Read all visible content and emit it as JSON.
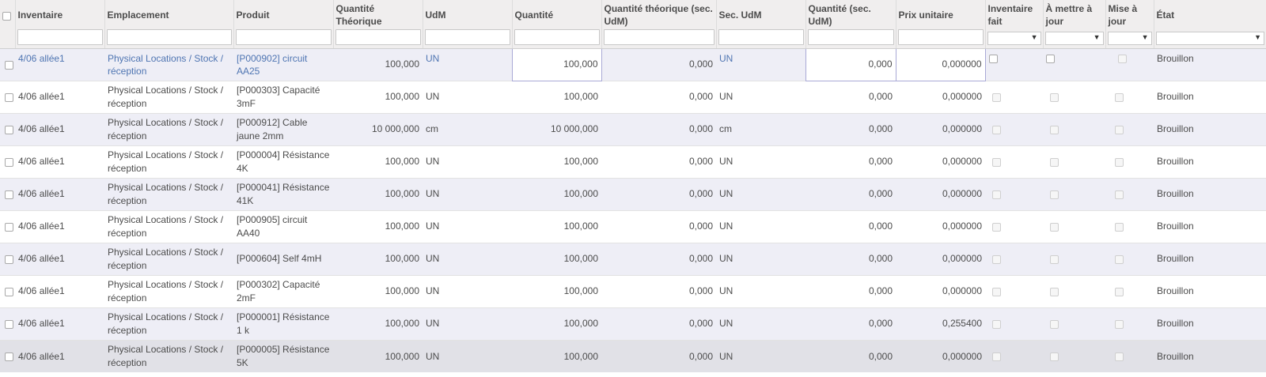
{
  "columns": [
    {
      "key": "inventaire",
      "label": "Inventaire"
    },
    {
      "key": "emplacement",
      "label": "Emplacement"
    },
    {
      "key": "produit",
      "label": "Produit"
    },
    {
      "key": "qte_theo",
      "label": "Quantité Théorique"
    },
    {
      "key": "udm",
      "label": "UdM"
    },
    {
      "key": "quantite",
      "label": "Quantité"
    },
    {
      "key": "qte_theo_sec",
      "label": "Quantité théorique (sec. UdM)"
    },
    {
      "key": "sec_udm",
      "label": "Sec. UdM"
    },
    {
      "key": "qte_sec",
      "label": "Quantité (sec. UdM)"
    },
    {
      "key": "prix",
      "label": "Prix unitaire"
    },
    {
      "key": "inv_fait",
      "label": "Inventaire fait"
    },
    {
      "key": "a_mettre",
      "label": "À mettre à jour"
    },
    {
      "key": "mise",
      "label": "Mise à jour"
    },
    {
      "key": "etat",
      "label": "État"
    }
  ],
  "rows": [
    {
      "inventaire": "4/06 allée1",
      "emplacement": "Physical Locations / Stock / réception",
      "produit": "[P000902] circuit AA25",
      "qte_theo": "100,000",
      "udm": "UN",
      "quantite": "100,000",
      "qte_theo_sec": "0,000",
      "sec_udm": "UN",
      "qte_sec": "0,000",
      "prix": "0,000000",
      "etat": "Brouillon"
    },
    {
      "inventaire": "4/06 allée1",
      "emplacement": "Physical Locations / Stock / réception",
      "produit": "[P000303] Capacité 3mF",
      "qte_theo": "100,000",
      "udm": "UN",
      "quantite": "100,000",
      "qte_theo_sec": "0,000",
      "sec_udm": "UN",
      "qte_sec": "0,000",
      "prix": "0,000000",
      "etat": "Brouillon"
    },
    {
      "inventaire": "4/06 allée1",
      "emplacement": "Physical Locations / Stock / réception",
      "produit": "[P000912] Cable jaune 2mm",
      "qte_theo": "10 000,000",
      "udm": "cm",
      "quantite": "10 000,000",
      "qte_theo_sec": "0,000",
      "sec_udm": "cm",
      "qte_sec": "0,000",
      "prix": "0,000000",
      "etat": "Brouillon"
    },
    {
      "inventaire": "4/06 allée1",
      "emplacement": "Physical Locations / Stock / réception",
      "produit": "[P000004] Résistance 4K",
      "qte_theo": "100,000",
      "udm": "UN",
      "quantite": "100,000",
      "qte_theo_sec": "0,000",
      "sec_udm": "UN",
      "qte_sec": "0,000",
      "prix": "0,000000",
      "etat": "Brouillon"
    },
    {
      "inventaire": "4/06 allée1",
      "emplacement": "Physical Locations / Stock / réception",
      "produit": "[P000041] Résistance 41K",
      "qte_theo": "100,000",
      "udm": "UN",
      "quantite": "100,000",
      "qte_theo_sec": "0,000",
      "sec_udm": "UN",
      "qte_sec": "0,000",
      "prix": "0,000000",
      "etat": "Brouillon"
    },
    {
      "inventaire": "4/06 allée1",
      "emplacement": "Physical Locations / Stock / réception",
      "produit": "[P000905] circuit AA40",
      "qte_theo": "100,000",
      "udm": "UN",
      "quantite": "100,000",
      "qte_theo_sec": "0,000",
      "sec_udm": "UN",
      "qte_sec": "0,000",
      "prix": "0,000000",
      "etat": "Brouillon"
    },
    {
      "inventaire": "4/06 allée1",
      "emplacement": "Physical Locations / Stock / réception",
      "produit": "[P000604] Self 4mH",
      "qte_theo": "100,000",
      "udm": "UN",
      "quantite": "100,000",
      "qte_theo_sec": "0,000",
      "sec_udm": "UN",
      "qte_sec": "0,000",
      "prix": "0,000000",
      "etat": "Brouillon"
    },
    {
      "inventaire": "4/06 allée1",
      "emplacement": "Physical Locations / Stock / réception",
      "produit": "[P000302] Capacité 2mF",
      "qte_theo": "100,000",
      "udm": "UN",
      "quantite": "100,000",
      "qte_theo_sec": "0,000",
      "sec_udm": "UN",
      "qte_sec": "0,000",
      "prix": "0,000000",
      "etat": "Brouillon"
    },
    {
      "inventaire": "4/06 allée1",
      "emplacement": "Physical Locations / Stock / réception",
      "produit": "[P000001] Résistance 1 k",
      "qte_theo": "100,000",
      "udm": "UN",
      "quantite": "100,000",
      "qte_theo_sec": "0,000",
      "sec_udm": "UN",
      "qte_sec": "0,000",
      "prix": "0,255400",
      "etat": "Brouillon"
    },
    {
      "inventaire": "4/06 allée1",
      "emplacement": "Physical Locations / Stock / réception",
      "produit": "[P000005] Résistance 5K",
      "qte_theo": "100,000",
      "udm": "UN",
      "quantite": "100,000",
      "qte_theo_sec": "0,000",
      "sec_udm": "UN",
      "qte_sec": "0,000",
      "prix": "0,000000",
      "etat": "Brouillon"
    }
  ]
}
